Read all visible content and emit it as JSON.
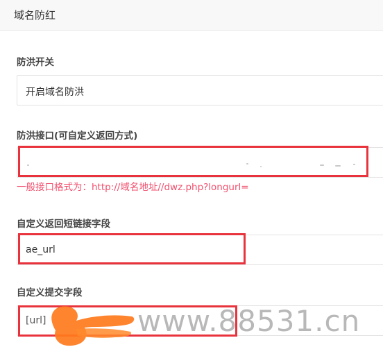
{
  "header": {
    "title": "域名防红"
  },
  "sections": {
    "anti_flood_switch": {
      "label": "防洪开关",
      "value": "开启域名防洪"
    },
    "anti_flood_api": {
      "label": "防洪接口(可自定义返回方式)",
      "value": "",
      "hint": "一般接口格式为：http://域名地址//dwz.php?longurl="
    },
    "return_short_link_field": {
      "label": "自定义返回短链接字段",
      "value": "ae_url"
    },
    "submit_field": {
      "label": "自定义提交字段",
      "value": "[url]"
    }
  },
  "watermark": "www.88531.cn",
  "colors": {
    "highlight": "#e8333d",
    "hint": "#f0506e"
  }
}
